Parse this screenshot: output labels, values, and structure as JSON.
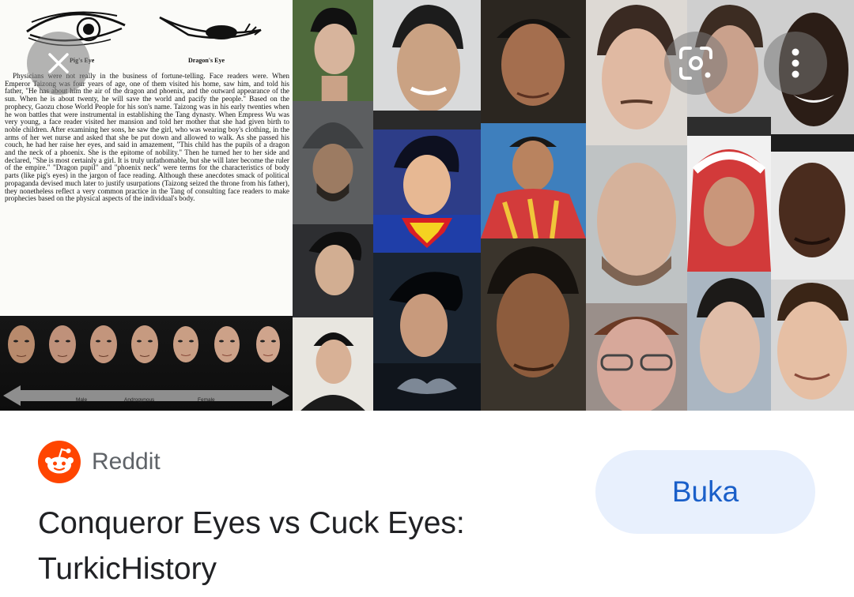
{
  "doc": {
    "pig_eye_caption": "Pig's Eye",
    "dragon_eye_caption": "Dragon's Eye",
    "body": "Physicians were not really in the business of fortune-telling. Face readers were. When Emperor Taizong was four years of age, one of them visited his home, saw him, and told his father, \"He has about him the air of the dragon and phoenix, and the outward appearance of the sun. When he is about twenty, he will save the world and pacify the people.\" Based on the prophecy, Gaozu chose World People for his son's name. Taizong was in his early twenties when he won battles that were instrumental in establishing the Tang dynasty. When Empress Wu was very young, a face reader visited her mansion and told her mother that she had given birth to noble children. After examining her sons, he saw the girl, who was wearing boy's clothing, in the arms of her wet nurse and asked that she be put down and allowed to walk. As she passed his couch, he had her raise her eyes, and said in amazement, \"This child has the pupils of a dragon and the neck of a phoenix. She is the epitome of nobility.\" Then he turned her to her side and declared, \"She is most certainly a girl. It is truly unfathomable, but she will later become the ruler of the empire.\" \"Dragon pupil\" and \"phoenix neck\" were terms for the characteristics of body parts (like pig's eyes) in the jargon of face reading. Although these anecdotes smack of political propaganda devised much later to justify usurpations (Taizong seized the throne from his father), they nonetheless reflect a very common practice in the Tang of consulting face readers to make prophecies based on the physical aspects of the individual's body.",
    "strip_labels": [
      "Male",
      "Androgynous",
      "Female"
    ]
  },
  "controls": {
    "close_icon": "close-icon",
    "lens_icon": "lens-icon",
    "more_icon": "more-vert-icon"
  },
  "result": {
    "source_name": "Reddit",
    "open_label": "Buka",
    "title": "Conqueror Eyes vs Cuck Eyes: TurkicHistory"
  },
  "colors": {
    "reddit_orange": "#FF4500",
    "button_bg": "#e8f0fd",
    "button_text": "#1a5fc9",
    "title_text": "#202124",
    "source_text": "#5f6368"
  }
}
